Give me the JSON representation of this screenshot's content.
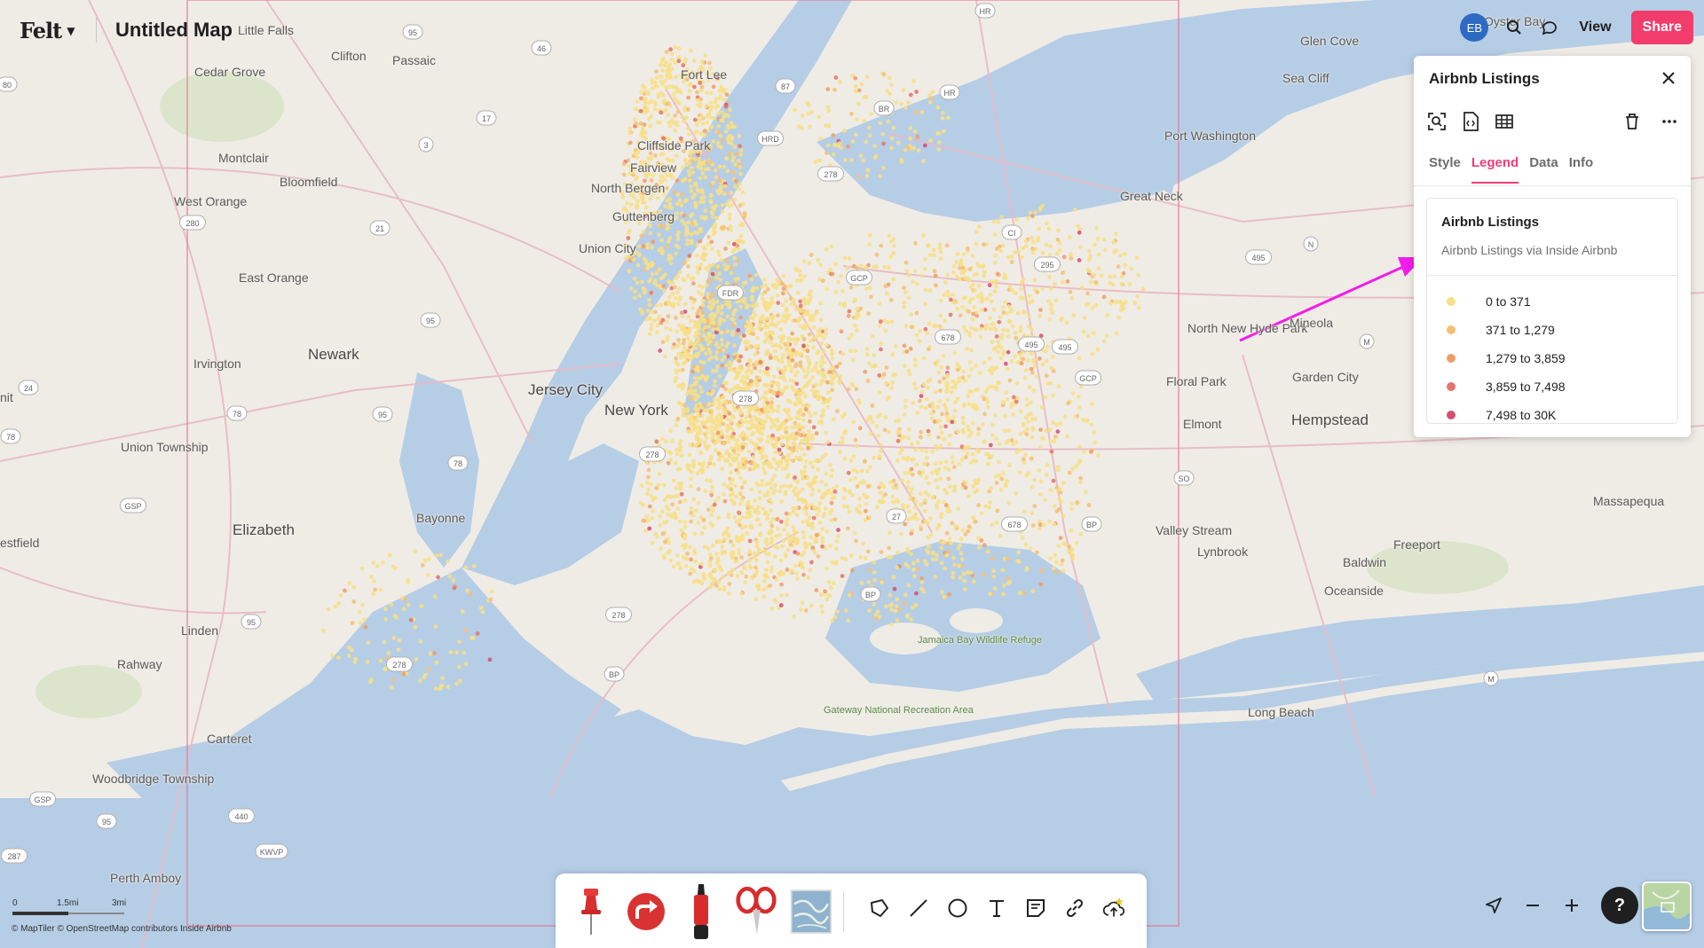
{
  "app": {
    "logo": "Felt",
    "map_title": "Untitled Map"
  },
  "topbar": {
    "avatar_initials": "EB",
    "view_label": "View",
    "share_label": "Share",
    "share_color": "#f23c6c",
    "avatar_color": "#2e6ac2"
  },
  "panel": {
    "title": "Airbnb Listings",
    "tabs": [
      {
        "label": "Style",
        "active": false
      },
      {
        "label": "Legend",
        "active": true
      },
      {
        "label": "Data",
        "active": false
      },
      {
        "label": "Info",
        "active": false
      }
    ],
    "legend": {
      "name": "Airbnb Listings",
      "description": "Airbnb Listings via Inside Airbnb",
      "items": [
        {
          "label": "0 to 371",
          "color": "#f7df86"
        },
        {
          "label": "371 to 1,279",
          "color": "#f5bf74"
        },
        {
          "label": "1,279 to 3,859",
          "color": "#ef9d67"
        },
        {
          "label": "3,859 to 7,498",
          "color": "#e5746a"
        },
        {
          "label": "7,498 to 30K",
          "color": "#d44f73"
        }
      ]
    }
  },
  "map": {
    "places": [
      {
        "name": "Little Falls"
      },
      {
        "name": "Clifton"
      },
      {
        "name": "Passaic"
      },
      {
        "name": "Cedar Grove"
      },
      {
        "name": "Fort Lee"
      },
      {
        "name": "Cliffside Park"
      },
      {
        "name": "Fairview"
      },
      {
        "name": "North Bergen"
      },
      {
        "name": "Guttenberg"
      },
      {
        "name": "Union City"
      },
      {
        "name": "Montclair"
      },
      {
        "name": "Bloomfield"
      },
      {
        "name": "West Orange"
      },
      {
        "name": "East Orange"
      },
      {
        "name": "Newark"
      },
      {
        "name": "Irvington"
      },
      {
        "name": "Jersey City"
      },
      {
        "name": "New York"
      },
      {
        "name": "Union Township"
      },
      {
        "name": "Bayonne"
      },
      {
        "name": "Elizabeth"
      },
      {
        "name": "Linden"
      },
      {
        "name": "Rahway"
      },
      {
        "name": "Carteret"
      },
      {
        "name": "Woodbridge Township"
      },
      {
        "name": "Perth Amboy"
      },
      {
        "name": "Glen Cove"
      },
      {
        "name": "Sea Cliff"
      },
      {
        "name": "Oyster Bay"
      },
      {
        "name": "Port Washington"
      },
      {
        "name": "Great Neck"
      },
      {
        "name": "North New Hyde Park"
      },
      {
        "name": "Mineola"
      },
      {
        "name": "Floral Park"
      },
      {
        "name": "Garden City"
      },
      {
        "name": "Hempstead"
      },
      {
        "name": "Elmont"
      },
      {
        "name": "Valley Stream"
      },
      {
        "name": "Lynbrook"
      },
      {
        "name": "Freeport"
      },
      {
        "name": "Baldwin"
      },
      {
        "name": "Massapequa"
      },
      {
        "name": "Oceanside"
      },
      {
        "name": "Long Beach"
      },
      {
        "name": "Jamaica Bay Wildlife Refuge"
      },
      {
        "name": "Gateway National Recreation Area"
      },
      {
        "name": "estfield"
      },
      {
        "name": "nit"
      }
    ],
    "shields": [
      "HR",
      "95",
      "46",
      "87",
      "BR",
      "HR",
      "HRD",
      "278",
      "CI",
      "295",
      "495",
      "GCP",
      "FDR",
      "678",
      "495",
      "GCP",
      "278",
      "278",
      "27",
      "678",
      "BP",
      "BP",
      "278",
      "BP",
      "95",
      "278",
      "440",
      "KWVP",
      "287",
      "GSP",
      "95",
      "17",
      "3",
      "21",
      "280",
      "95",
      "95",
      "78",
      "78",
      "GSP",
      "24",
      "78",
      "80",
      "SO",
      "N",
      "M",
      "495",
      "M"
    ]
  },
  "scale": {
    "labels": [
      "0",
      "1.5mi",
      "3mi"
    ]
  },
  "attribution": "© MapTiler  © OpenStreetMap contributors  Inside Airbnb"
}
